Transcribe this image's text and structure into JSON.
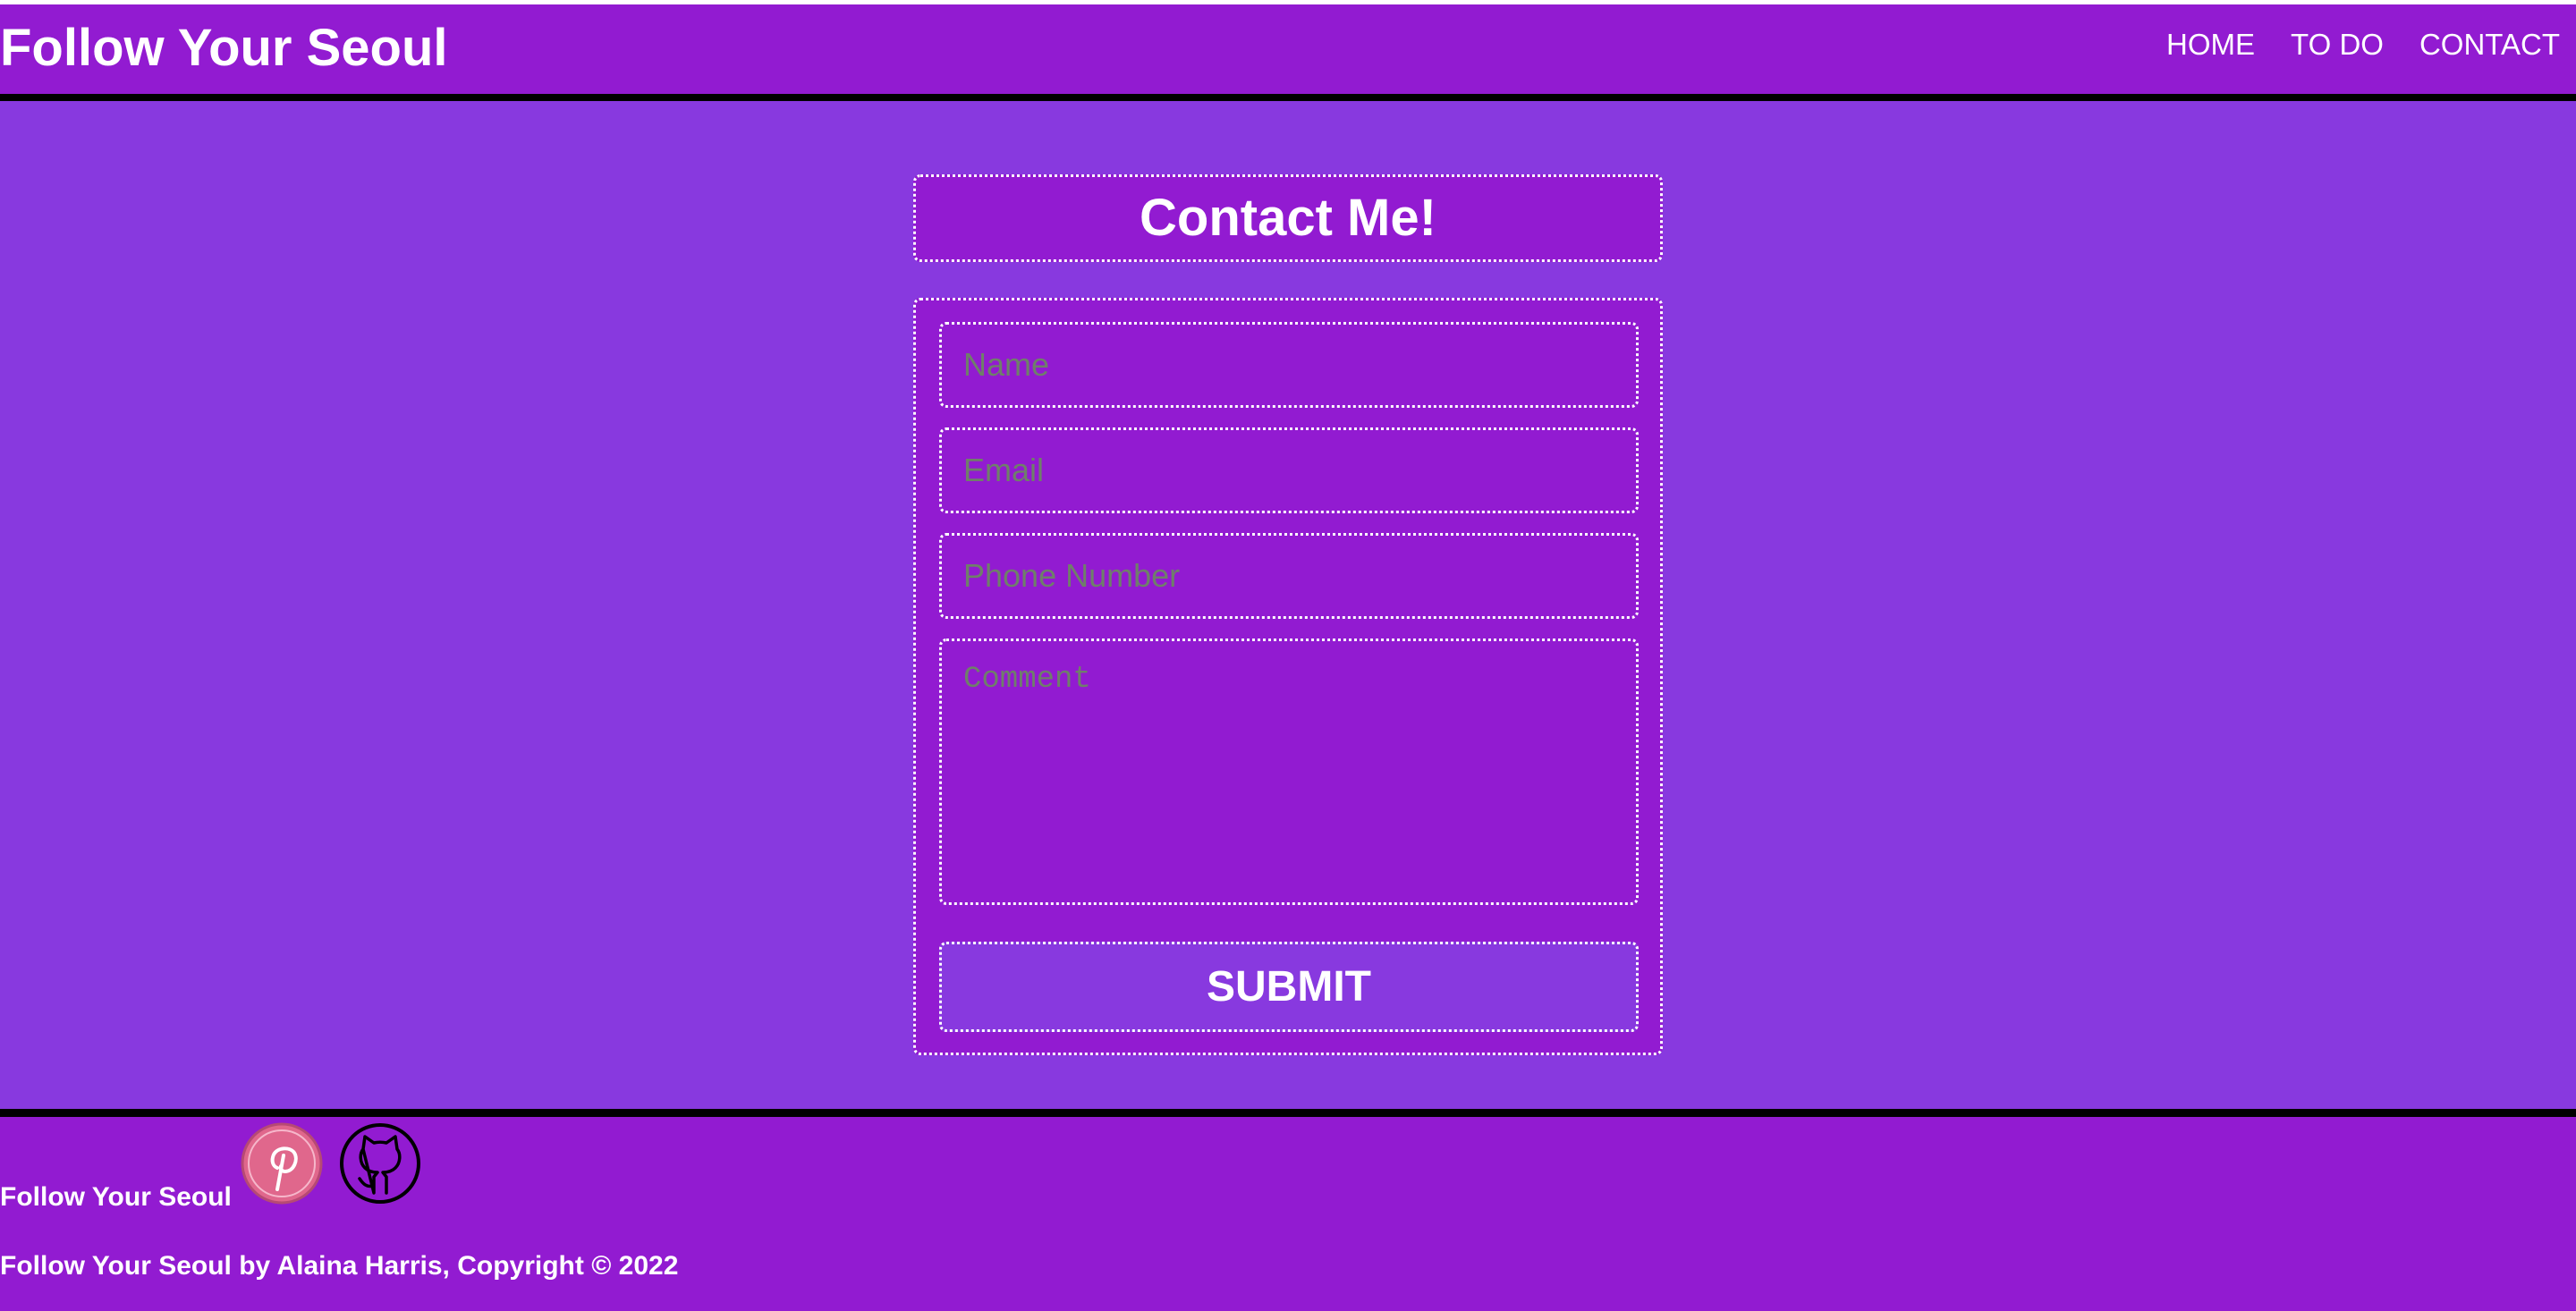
{
  "header": {
    "site_title": "Follow Your Seoul",
    "nav": [
      {
        "label": "HOME"
      },
      {
        "label": "TO DO"
      },
      {
        "label": "CONTACT"
      }
    ]
  },
  "contact": {
    "title": "Contact Me!",
    "form": {
      "name_placeholder": "Name",
      "name_value": "",
      "email_placeholder": "Email",
      "email_value": "",
      "phone_placeholder": "Phone Number",
      "phone_value": "",
      "comment_placeholder": "Comment",
      "comment_value": "",
      "submit_label": "SUBMIT"
    }
  },
  "footer": {
    "brand": "Follow Your Seoul",
    "social": [
      {
        "icon": "pinterest-icon"
      },
      {
        "icon": "github-icon"
      }
    ],
    "copyright": "Follow Your Seoul by Alaina Harris, Copyright © 2022"
  },
  "colors": {
    "page_background": "#8839DF",
    "header_background": "#921BD1",
    "form_background": "#921BD1",
    "submit_background": "#8839DF",
    "divider": "#000000",
    "text": "#FFFFFF",
    "placeholder": "#6F7F6A",
    "pinterest_badge": "#E0678C"
  }
}
